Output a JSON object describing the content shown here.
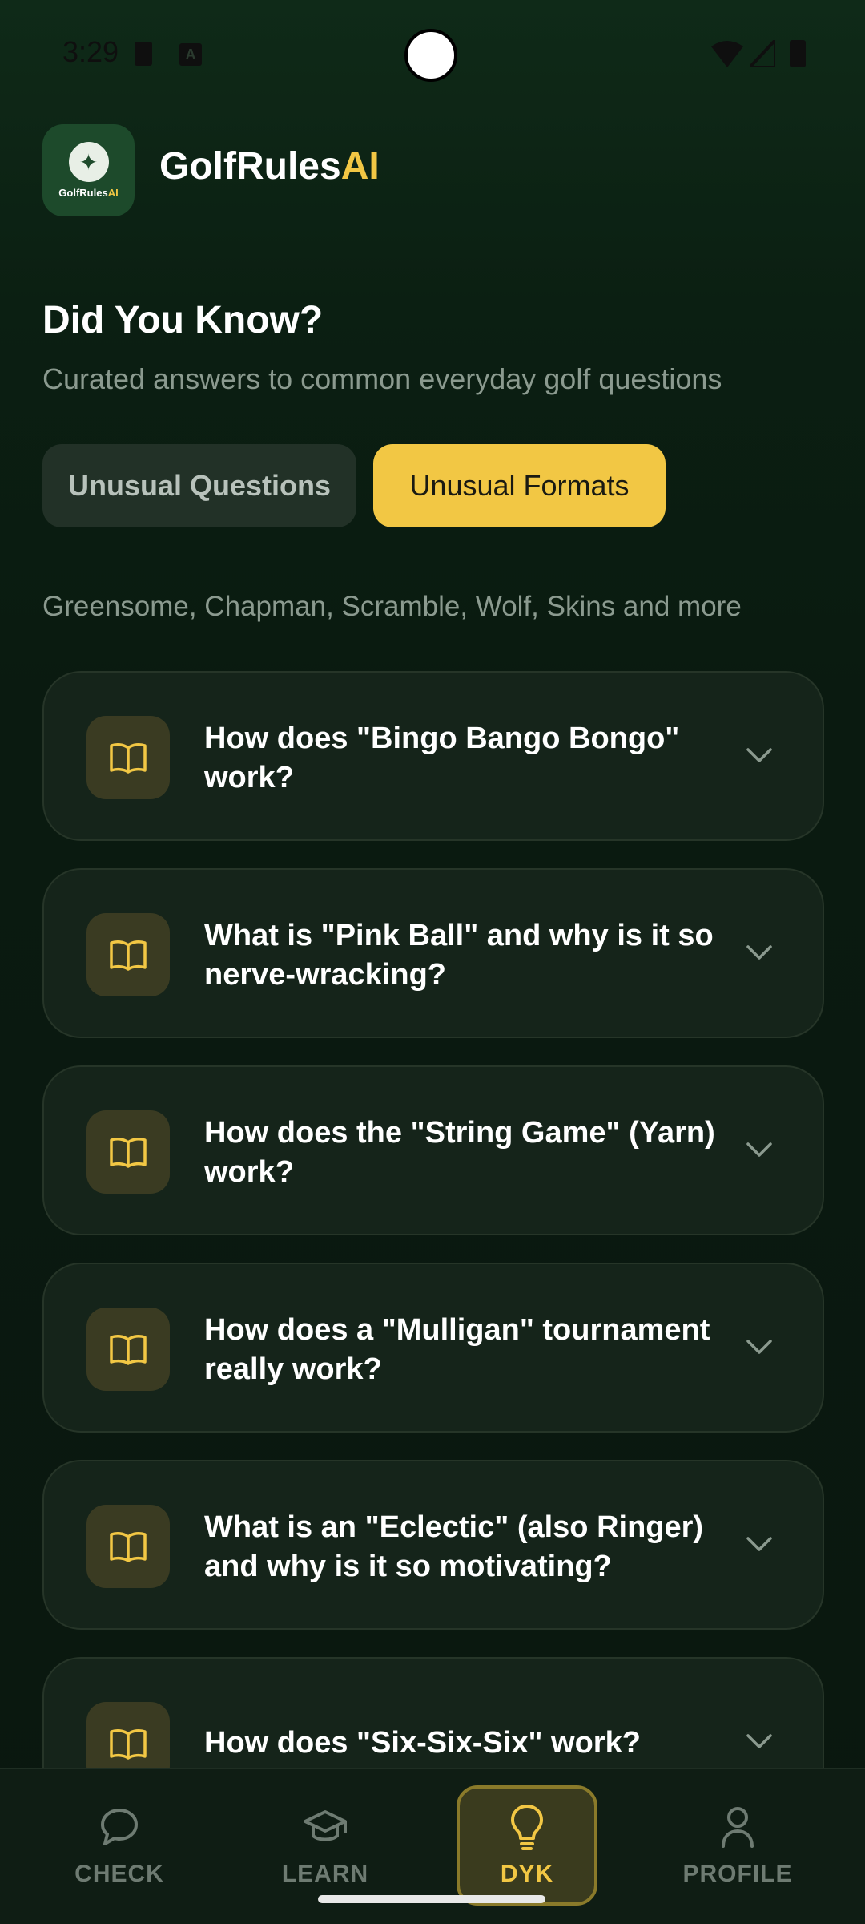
{
  "status_bar": {
    "time": "3:29",
    "ab_label": "A"
  },
  "app": {
    "name_main": "GolfRules",
    "name_accent": "AI",
    "logo_text_main": "GolfRules",
    "logo_text_accent": "AI"
  },
  "page": {
    "title": "Did You Know?",
    "subtitle": "Curated answers to common everyday golf questions"
  },
  "tabs": [
    {
      "label": "Unusual Questions",
      "active": false
    },
    {
      "label": "Unusual Formats",
      "active": true
    }
  ],
  "section_description": "Greensome, Chapman, Scramble, Wolf, Skins and more",
  "questions": [
    {
      "text": "How does \"Bingo Bango Bongo\" work?"
    },
    {
      "text": "What is \"Pink Ball\" and why is it so nerve-wracking?"
    },
    {
      "text": "How does the \"String Game\" (Yarn) work?"
    },
    {
      "text": "How does a \"Mulligan\" tournament really work?"
    },
    {
      "text": "What is an \"Eclectic\" (also Ringer) and why is it so motivating?"
    },
    {
      "text": "How does \"Six-Six-Six\" work?"
    }
  ],
  "bottom_nav": [
    {
      "label": "CHECK",
      "icon": "chat-bubble-icon",
      "active": false
    },
    {
      "label": "LEARN",
      "icon": "graduation-cap-icon",
      "active": false
    },
    {
      "label": "DYK",
      "icon": "lightbulb-icon",
      "active": true
    },
    {
      "label": "PROFILE",
      "icon": "person-icon",
      "active": false
    }
  ],
  "colors": {
    "accent": "#f2c744",
    "background": "#0a1a10",
    "card": "#15241a",
    "muted_text": "#8b9a8f"
  }
}
